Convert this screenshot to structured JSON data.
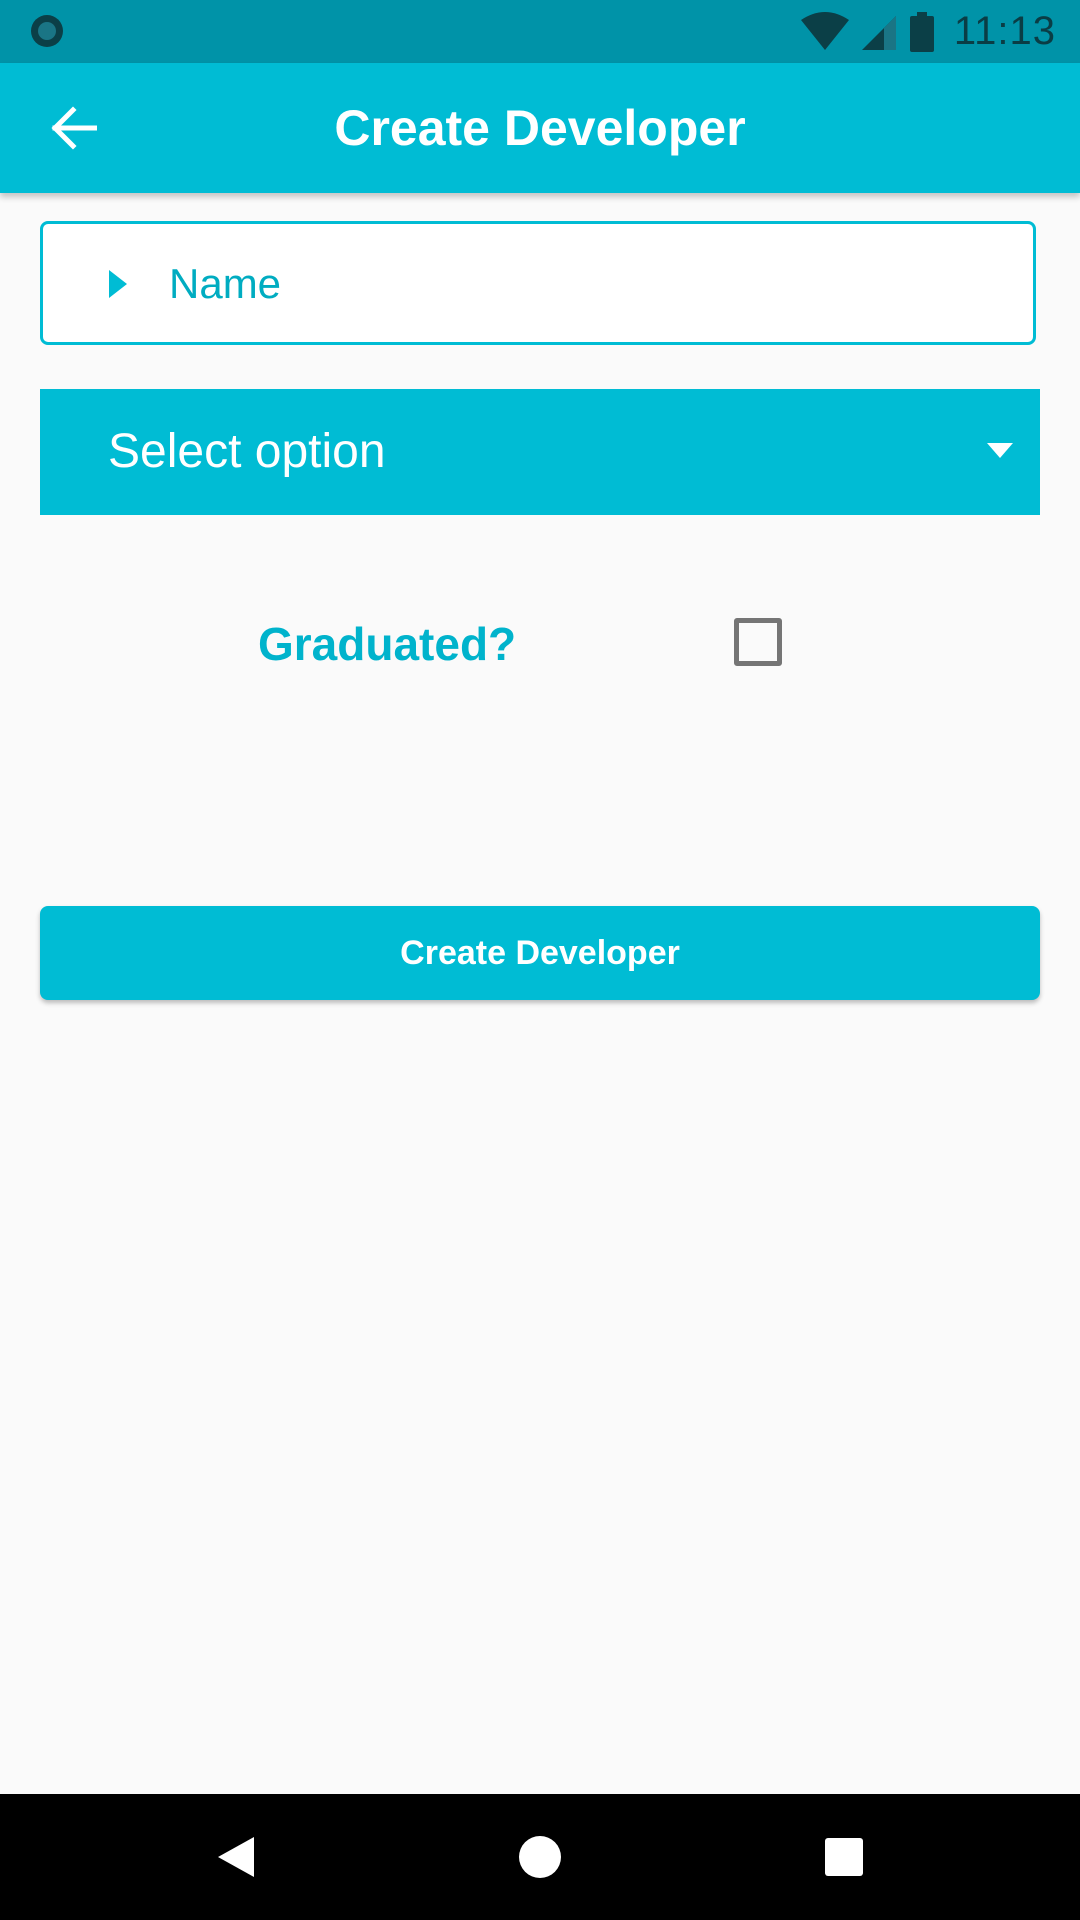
{
  "status_bar": {
    "time": "11:13",
    "icons": [
      "circle-notification-icon",
      "wifi-icon",
      "signal-icon",
      "battery-icon"
    ]
  },
  "app_bar": {
    "title": "Create Developer",
    "back_icon": "arrow-left-icon"
  },
  "form": {
    "name_field": {
      "placeholder": "Name",
      "value": "",
      "icon": "caret-right-icon"
    },
    "select": {
      "selected": "Select option",
      "icon": "caret-down-icon"
    },
    "graduated": {
      "label": "Graduated?",
      "checked": false
    },
    "submit_label": "Create Developer"
  },
  "nav_bar": {
    "icons": [
      "back-triangle-icon",
      "home-circle-icon",
      "recents-square-icon"
    ]
  },
  "colors": {
    "primary": "#00bcd4",
    "primary_dark": "#0093a8",
    "background": "#fafafa",
    "checkbox_border": "#757575"
  }
}
